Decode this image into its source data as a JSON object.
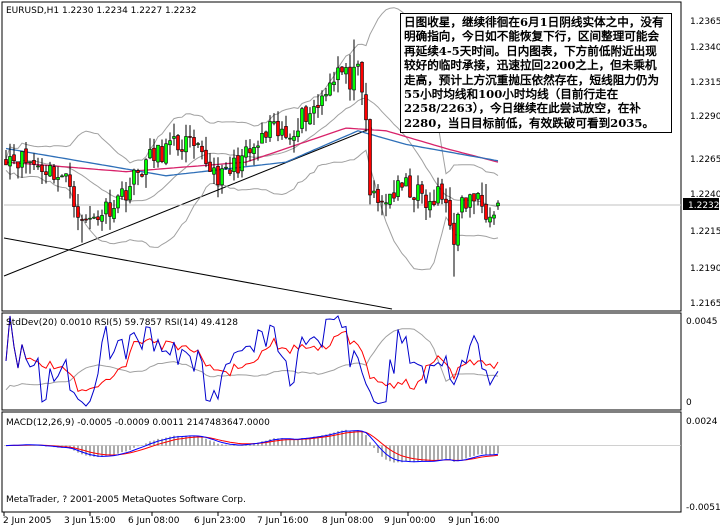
{
  "main": {
    "symbol_header": "EURUSD,H1  1.2230 1.2234 1.2227 1.2232",
    "current_price": "1.2232",
    "y_ticks": [
      "1.2365",
      "1.2340",
      "1.2315",
      "1.2290",
      "1.2265",
      "1.2240",
      "1.2215",
      "1.2190",
      "1.2165"
    ]
  },
  "rsi": {
    "header": "StdDev(20) 0.0010  RSI(5) 59.7857  RSI(14) 49.4128",
    "y_ticks": [
      "0.0045",
      "0"
    ]
  },
  "macd": {
    "header": "MACD(12,26,9) -0.0005 -0.0009 0.0011 2147483647.0000",
    "y_ticks": [
      "0.0024",
      "-0.0051"
    ],
    "copyright": "MetaTrader, ? 2001-2005 MetaQuotes Software Corp."
  },
  "x_axis": {
    "labels": [
      "2 Jun 2005",
      "3 Jun 15:00",
      "6 Jun 08:00",
      "6 Jun 23:00",
      "7 Jun 16:00",
      "8 Jun 08:00",
      "9 Jun 00:00",
      "9 Jun 16:00"
    ]
  },
  "annotation": {
    "text": "日图收星，继续徘徊在6月1日阴线实体之中，没有明确指向，今日如不能恢复下行，区间整理可能会再延续4-5天时间。日内图表，下方前低附近出现较好的临时承接，迅速拉回2200之上，但未乘机走高，预计上方沉重抛压依然存在，短线阻力仍为55小时均线和100小时均线（目前行走在2258/2263），今日继续在此尝试放空，在补2280，当日目标前低，有效跌破可看到2035。"
  },
  "colors": {
    "bull": "#00ff00",
    "bear": "#ff0000",
    "ma55": "#d8226a",
    "ma100": "#2e6fb8",
    "ma200": "#1e3aa8",
    "bollinger": "#a0a0a0",
    "rsi5": "#0000cc",
    "rsi14": "#ff0000",
    "macd_signal": "#ff0000",
    "macd_line": "#0000ff"
  },
  "chart_data": {
    "type": "candlestick",
    "symbol": "EURUSD",
    "timeframe": "H1",
    "ohlc_last": {
      "open": 1.223,
      "high": 1.2234,
      "low": 1.2227,
      "close": 1.2232
    },
    "ylim": [
      1.2155,
      1.2378
    ],
    "key_closes": [
      {
        "x": "2 Jun 2005",
        "value": 1.2268
      },
      {
        "x": "3 Jun 15:00",
        "value": 1.2218
      },
      {
        "x": "6 Jun 08:00",
        "value": 1.2262
      },
      {
        "x": "6 Jun 23:00",
        "value": 1.2248
      },
      {
        "x": "7 Jun 16:00",
        "value": 1.23
      },
      {
        "x": "8 Jun 08:00",
        "value": 1.233
      },
      {
        "x": "9 Jun 00:00",
        "value": 1.223
      },
      {
        "x": "9 Jun 16:00",
        "value": 1.2232
      }
    ],
    "indicators": {
      "StdDev(20)": 0.001,
      "RSI(5)": 59.7857,
      "RSI(14)": 49.4128,
      "MACD(12,26,9)": [
        -0.0005,
        -0.0009,
        0.0011,
        2147483647.0
      ]
    }
  }
}
